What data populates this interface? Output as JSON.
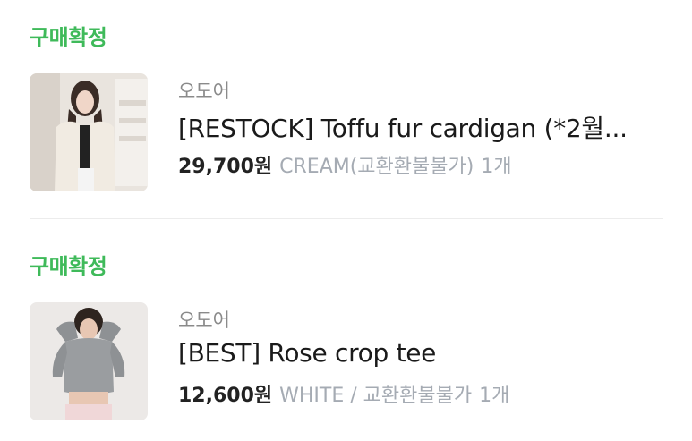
{
  "orders": [
    {
      "status": "구매확정",
      "brand": "오도어",
      "title": "[RESTOCK]  Toffu fur cardigan (*2월...",
      "price": "29,700원",
      "option": "CREAM(교환환불불가)",
      "qty": "1개"
    },
    {
      "status": "구매확정",
      "brand": "오도어",
      "title": "[BEST] Rose crop tee",
      "price": "12,600원",
      "option": "WHITE / 교환환불불가",
      "qty": "1개"
    }
  ],
  "colors": {
    "status_green": "#3fba5a",
    "muted": "#a5abb3"
  }
}
